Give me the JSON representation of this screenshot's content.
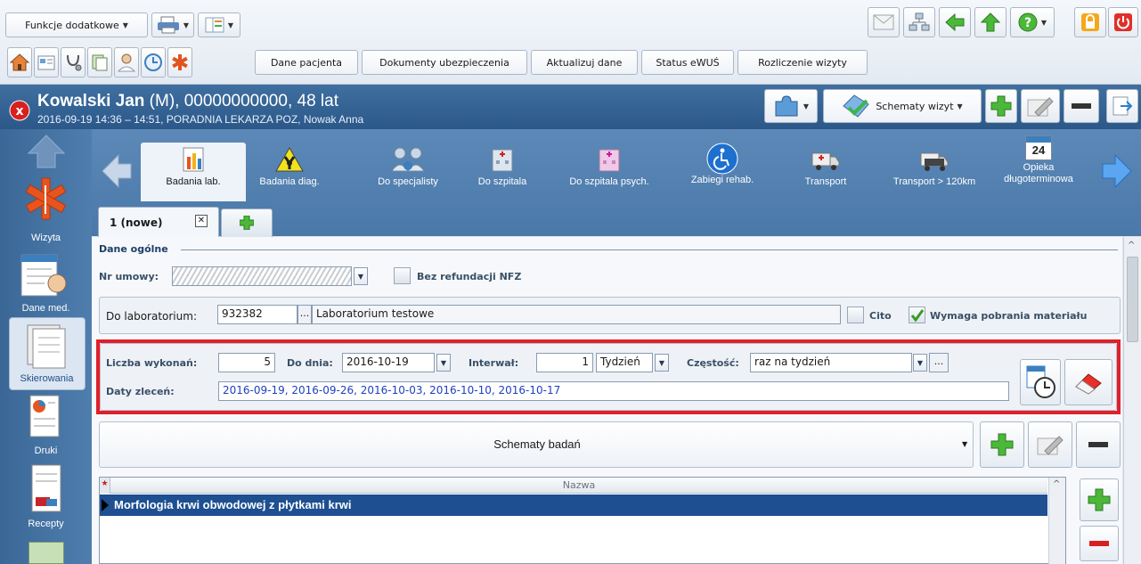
{
  "toolbar": {
    "extras_label": "Funkcje dodatkowe",
    "nav_buttons": [
      "Dane pacjenta",
      "Dokumenty ubezpieczenia",
      "Aktualizuj dane",
      "Status eWUŚ",
      "Rozliczenie wizyty"
    ]
  },
  "patient": {
    "name": "Kowalski Jan",
    "details": " (M), 00000000000, 48 lat",
    "visit": "2016-09-19 14:36 – 14:51, PORADNIA LEKARZA POZ, Nowak Anna",
    "schemes_label": "Schematy wizyt"
  },
  "sidebar": {
    "items": [
      {
        "label": "Wizyta"
      },
      {
        "label": "Dane med."
      },
      {
        "label": "Skierowania"
      },
      {
        "label": "Druki"
      },
      {
        "label": "Recepty"
      }
    ]
  },
  "referrals": {
    "items": [
      {
        "label": "Badania lab.",
        "active": true
      },
      {
        "label": "Badania diag."
      },
      {
        "label": "Do specjalisty"
      },
      {
        "label": "Do szpitala"
      },
      {
        "label": "Do szpitala psych."
      },
      {
        "label": "Zabiegi rehab."
      },
      {
        "label": "Transport"
      },
      {
        "label": "Transport > 120km"
      },
      {
        "label_line1": "Opieka",
        "label_line2": "długoterminowa",
        "badge": "24"
      }
    ]
  },
  "tab": {
    "label": "1 (nowe)"
  },
  "general": {
    "section_title": "Dane ogólne",
    "contract_label": "Nr umowy:",
    "no_refund_label": "Bez refundacji NFZ",
    "lab_label": "Do laboratorium:",
    "lab_code": "932382",
    "lab_name": "Laboratorium testowe",
    "cito_label": "Cito",
    "requires_material_label": "Wymaga pobrania materiału"
  },
  "schedule": {
    "count_label": "Liczba wykonań:",
    "count_value": "5",
    "until_label": "Do dnia:",
    "until_value": "2016-10-19",
    "interval_label": "Interwał:",
    "interval_value": "1",
    "interval_unit": "Tydzień",
    "frequency_label": "Częstość:",
    "frequency_value": "raz na tydzień",
    "dates_label": "Daty zleceń:",
    "dates_value": "2016-09-19, 2016-09-26, 2016-10-03, 2016-10-10, 2016-10-17"
  },
  "tests": {
    "schemes_label": "Schematy badań",
    "column_name": "Nazwa",
    "rows": [
      "Morfologia krwi obwodowej z płytkami krwi"
    ]
  }
}
